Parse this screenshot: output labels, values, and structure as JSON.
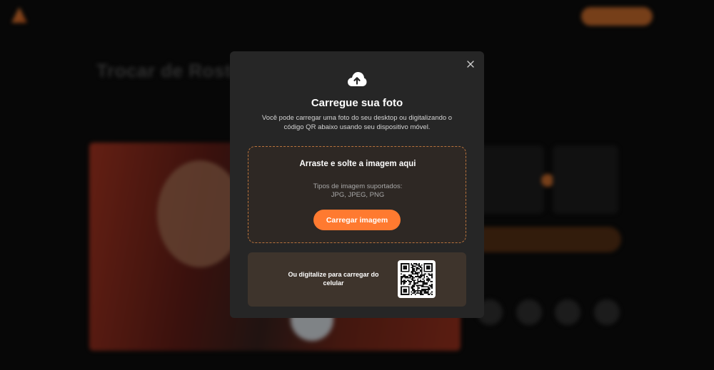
{
  "background": {
    "brand": "",
    "nav": [
      "",
      "",
      "",
      "",
      ""
    ],
    "cta_label": "",
    "login_label": "",
    "breadcrumb": "",
    "title": "Trocar de Rosto                                 Troca de Rosto",
    "subtitle": "",
    "thumb_labels": [
      "",
      ""
    ]
  },
  "modal": {
    "title": "Carregue sua foto",
    "description": "Você pode carregar uma foto do seu desktop ou digitalizando o código QR abaixo usando seu dispositivo móvel.",
    "drop_title": "Arraste e solte a imagem aqui",
    "supported_label": "Tipos de imagem suportados:",
    "supported_types": "JPG, JPEG, PNG",
    "upload_button": "Carregar imagem",
    "qr_text": "Ou digitalize para carregar do celular",
    "close_icon": "close-icon",
    "upload_icon": "cloud-upload-icon"
  },
  "colors": {
    "accent": "#ff7a30",
    "modal_bg": "#262626",
    "dropzone_border": "#b8733d",
    "qr_panel_bg": "#3e342c"
  }
}
